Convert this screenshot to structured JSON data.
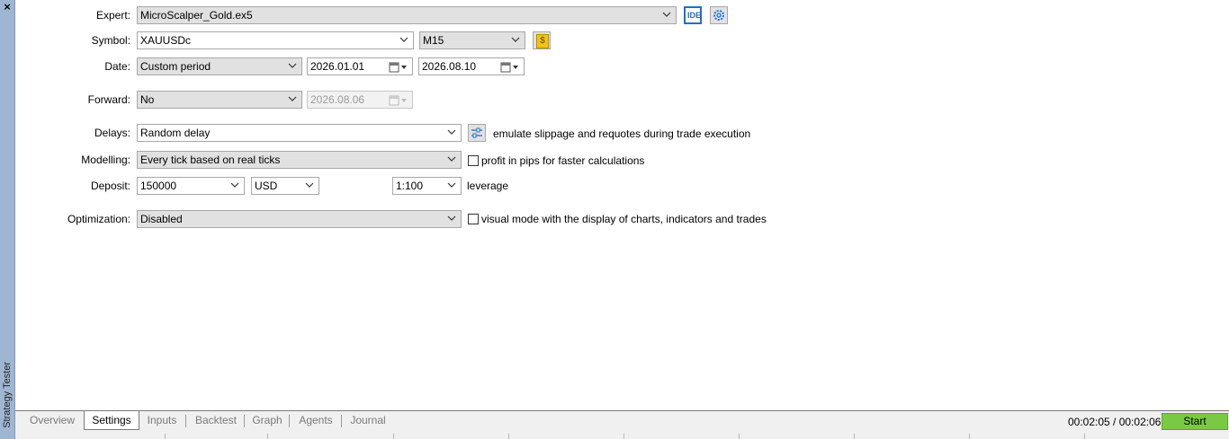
{
  "sidebar": {
    "close_glyph": "×",
    "title": "Strategy Tester"
  },
  "form": {
    "expert": {
      "label": "Expert:",
      "value": "MicroScalper_Gold.ex5",
      "ide_label": "IDE"
    },
    "symbol": {
      "label": "Symbol:",
      "value": "XAUUSDc",
      "timeframe": "M15",
      "symbol_icon": "$"
    },
    "date": {
      "label": "Date:",
      "period": "Custom period",
      "from": "2026.01.01",
      "to": "2026.08.10"
    },
    "forward": {
      "label": "Forward:",
      "value": "No",
      "date": "2026.08.06"
    },
    "delays": {
      "label": "Delays:",
      "value": "Random delay",
      "note": "emulate slippage and requotes during trade execution"
    },
    "modelling": {
      "label": "Modelling:",
      "value": "Every tick based on real ticks",
      "checkbox_label": "profit in pips for faster calculations"
    },
    "deposit": {
      "label": "Deposit:",
      "value": "150000",
      "currency": "USD",
      "leverage": "1:100",
      "leverage_label": "leverage"
    },
    "optimization": {
      "label": "Optimization:",
      "value": "Disabled",
      "checkbox_label": "visual mode with the display of charts, indicators and trades"
    }
  },
  "tabs": [
    "Overview",
    "Settings",
    "Inputs",
    "Backtest",
    "Graph",
    "Agents",
    "Journal"
  ],
  "active_tab": "Settings",
  "status": {
    "timer": "00:02:05 / 00:02:06",
    "start_label": "Start"
  },
  "colors": {
    "start_button": "#7ac943",
    "sidebar": "#9fb6d2",
    "ide_border": "#1e6fd0"
  }
}
